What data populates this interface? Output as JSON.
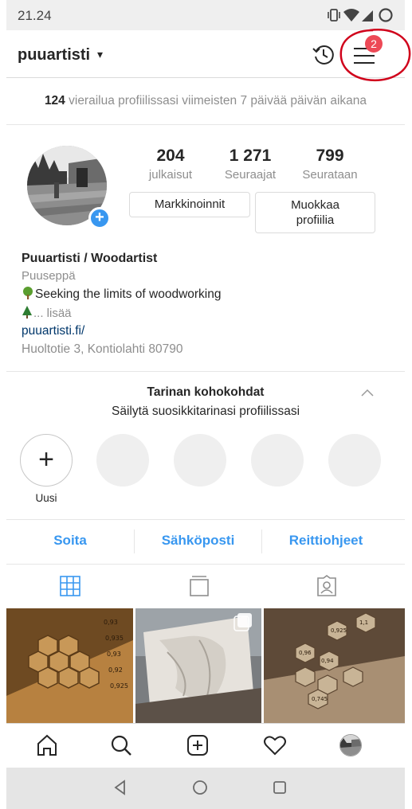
{
  "status_bar": {
    "time": "21.24",
    "icons": [
      "vibrate-icon",
      "wifi-icon",
      "signal-icon",
      "battery-icon"
    ]
  },
  "header": {
    "username": "puuartisti",
    "caret": "▾",
    "notification_count": "2",
    "icons": [
      "history-icon",
      "menu-icon"
    ]
  },
  "visits": {
    "count": "124",
    "text": " vierailua profiilissasi viimeisten 7 päivää päivän aikana"
  },
  "profile": {
    "stats": [
      {
        "value": "204",
        "label": "julkaisut"
      },
      {
        "value": "1 271",
        "label": "Seuraajat"
      },
      {
        "value": "799",
        "label": "Seurataan"
      }
    ],
    "buttons": {
      "promotions": "Markkinoinnit",
      "edit_line1": "Muokkaa",
      "edit_line2": "profiilia"
    },
    "avatar_add": "+"
  },
  "bio": {
    "name": "Puuartisti / Woodartist",
    "category": "Puuseppä",
    "line1": "Seeking the limits of woodworking",
    "line2": "... lisää",
    "link": "puuartisti.fi/",
    "address": "Huoltotie 3, Kontiolahti 80790"
  },
  "highlights": {
    "title": "Tarinan kohokohdat",
    "subtitle": "Säilytä suosikkitarinasi profiilissasi",
    "new_symbol": "+",
    "new_label": "Uusi"
  },
  "contact": {
    "call": "Soita",
    "email": "Sähköposti",
    "directions": "Reittiohjeet"
  },
  "tabs": [
    "grid-icon",
    "igtv-icon",
    "tagged-icon"
  ],
  "bottom_nav": [
    "home-icon",
    "search-icon",
    "add-post-icon",
    "activity-heart-icon",
    "profile-avatar"
  ],
  "android_nav": [
    "back-icon",
    "home-circle-icon",
    "recents-icon"
  ],
  "colors": {
    "accent": "#3897f0",
    "badge": "#ed4956",
    "link": "#00376b",
    "annotation": "#d0021b"
  }
}
